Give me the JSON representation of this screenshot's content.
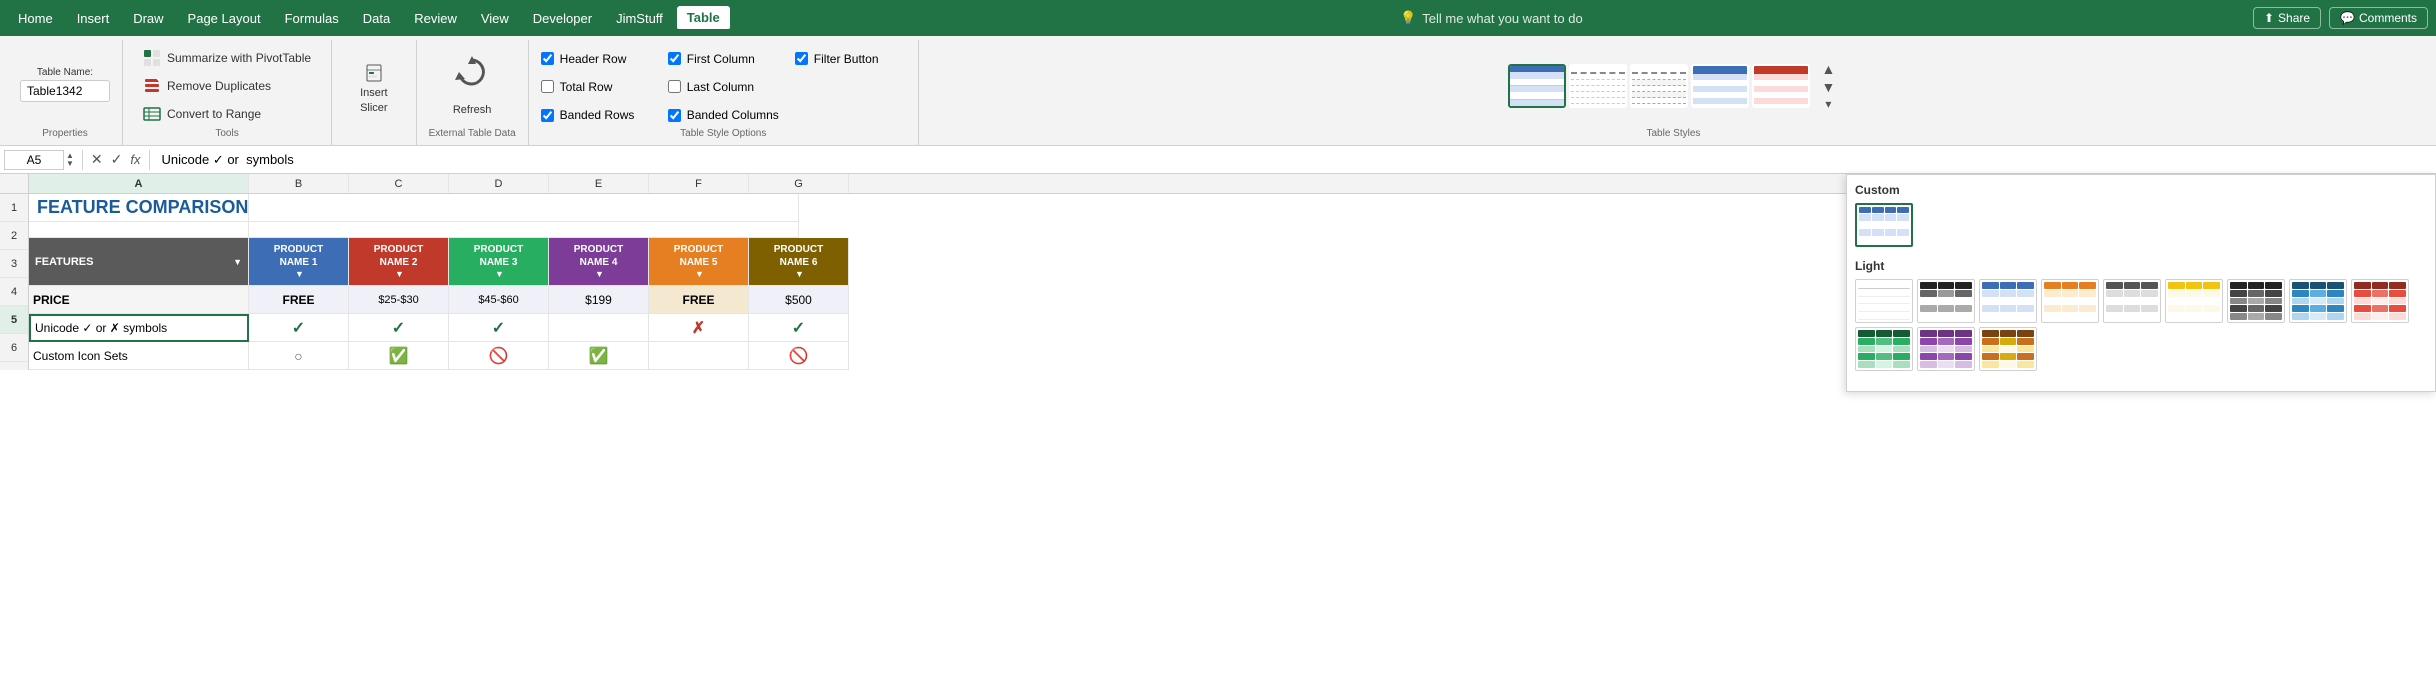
{
  "menuBar": {
    "items": [
      "Home",
      "Insert",
      "Draw",
      "Page Layout",
      "Formulas",
      "Data",
      "Review",
      "View",
      "Developer",
      "JimStuff",
      "Table"
    ],
    "activeItem": "Table",
    "search": "Tell me what you want to do",
    "shareLabel": "Share",
    "commentsLabel": "Comments"
  },
  "ribbon": {
    "groups": {
      "properties": {
        "label": "Properties",
        "tableNameLabel": "Table Name:",
        "tableNameValue": "Table1342"
      },
      "tools": {
        "label": "Tools",
        "buttons": [
          "Summarize with PivotTable",
          "Remove Duplicates",
          "Convert to Range"
        ]
      },
      "insertSlicer": {
        "label": "Insert Slicer",
        "buttonLabel": "Insert\nSlicer"
      },
      "externalTableData": {
        "label": "External Table Data",
        "refreshLabel": "Refresh"
      },
      "tableStyleOptions": {
        "label": "Table Style Options",
        "checkboxes": [
          {
            "label": "Header Row",
            "checked": true
          },
          {
            "label": "First Column",
            "checked": true
          },
          {
            "label": "Filter Button",
            "checked": true
          },
          {
            "label": "Total Row",
            "checked": false
          },
          {
            "label": "Last Column",
            "checked": false
          },
          {
            "label": "Banded Rows",
            "checked": true
          },
          {
            "label": "Banded Columns",
            "checked": true
          }
        ]
      },
      "tableStyles": {
        "label": "Table Styles"
      }
    }
  },
  "formulaBar": {
    "cellRef": "A5",
    "formula": "Unicode ✓ or  symbols"
  },
  "sheet": {
    "colHeaders": [
      "A",
      "B",
      "C",
      "D",
      "E",
      "F",
      "G"
    ],
    "row1": {
      "title": "FEATURE COMPARISON"
    },
    "row3": {
      "features": "FEATURES",
      "p1": "PRODUCT\nNAME 1",
      "p2": "PRODUCT\nNAME 2",
      "p3": "PRODUCT\nNAME 3",
      "p4": "PRODUCT\nNAME 4",
      "p5": "PRODUCT\nNAME 5",
      "p6": "PRODUCT\nNAME 6"
    },
    "row4": {
      "label": "PRICE",
      "p1": "FREE",
      "p2": "$25-$30",
      "p3": "$45-$60",
      "p4": "$199",
      "p5": "FREE",
      "p6": "$500"
    },
    "row5": {
      "label": "Unicode ✓ or ✗ symbols",
      "p1": "✓",
      "p2": "✓",
      "p3": "✓",
      "p4": "",
      "p5": "✗",
      "p6": "✓"
    },
    "row6": {
      "label": "Custom Icon Sets",
      "p1": "○",
      "p2": "✅",
      "p3": "🚫",
      "p4": "✅",
      "p5": "",
      "p6": "🚫"
    }
  },
  "stylesPanel": {
    "customLabel": "Custom",
    "lightLabel": "Light",
    "selectedSwatch": 0
  }
}
